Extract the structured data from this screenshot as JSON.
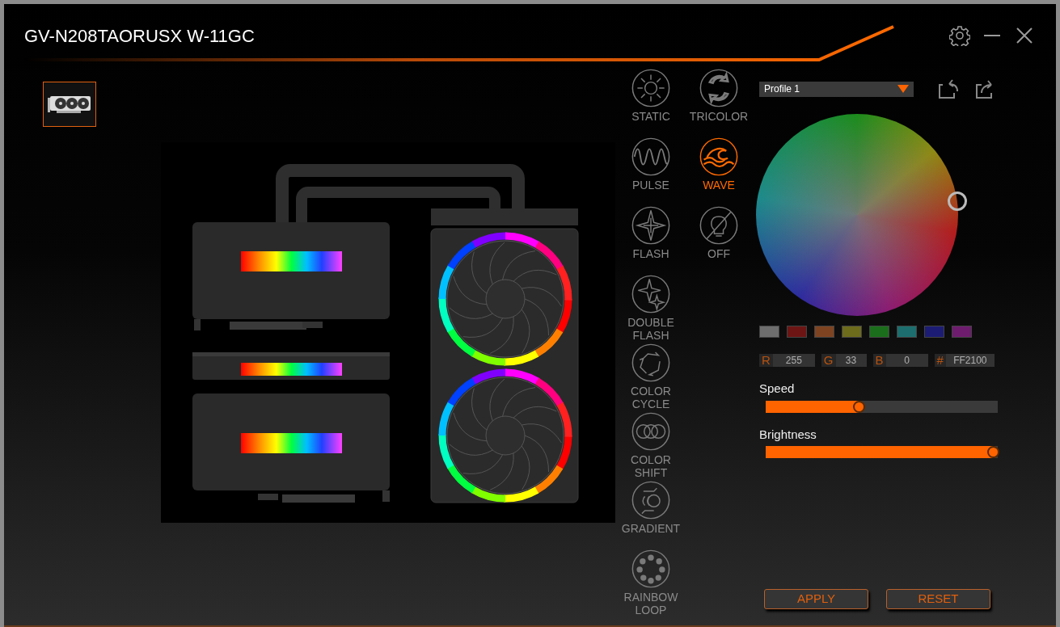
{
  "window": {
    "title": "GV-N208TAORUSX W-11GC"
  },
  "devices": [
    {
      "selected": true
    }
  ],
  "effects": [
    {
      "label": "STATIC",
      "kind": "sun",
      "selected": false
    },
    {
      "label": "TRICOLOR",
      "kind": "cycle",
      "selected": false
    },
    {
      "label": "PULSE",
      "kind": "sine",
      "selected": false
    },
    {
      "label": "WAVE",
      "kind": "wave",
      "selected": true
    },
    {
      "label": "FLASH",
      "kind": "star",
      "selected": false
    },
    {
      "label": "OFF",
      "kind": "bulb-off",
      "selected": false
    },
    {
      "label": "DOUBLE FLASH",
      "kind": "double-star",
      "selected": false
    },
    {
      "label": "COLOR CYCLE",
      "kind": "arrows",
      "selected": false
    },
    {
      "label": "COLOR SHIFT",
      "kind": "rings",
      "selected": false
    },
    {
      "label": "GRADIENT",
      "kind": "gradient",
      "selected": false
    },
    {
      "label": "RAINBOW LOOP",
      "kind": "dots",
      "selected": false
    }
  ],
  "profile": {
    "value": "Profile 1"
  },
  "swatches": [
    {
      "color": "#6e6e6e"
    },
    {
      "color": "#6d1515"
    },
    {
      "color": "#7e4422"
    },
    {
      "color": "#6d6b1c"
    },
    {
      "color": "#1b6e1b"
    },
    {
      "color": "#1d6e6e"
    },
    {
      "color": "#1c1c74"
    },
    {
      "color": "#6e1c6e"
    }
  ],
  "rgb": [
    {
      "label": "R",
      "value": "255"
    },
    {
      "label": "G",
      "value": "33"
    },
    {
      "label": "B",
      "value": "0"
    },
    {
      "label": "#",
      "value": "FF2100"
    }
  ],
  "sliders": [
    {
      "label": "Speed",
      "level": 0.4
    },
    {
      "label": "Brightness",
      "level": 0.98
    }
  ],
  "buttons": [
    "APPLY",
    "RESET"
  ]
}
